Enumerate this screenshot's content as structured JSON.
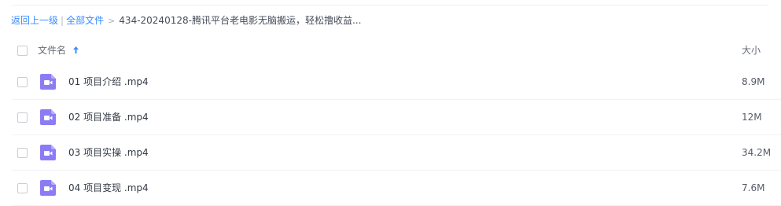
{
  "breadcrumb": {
    "back_label": "返回上一级",
    "separator": "|",
    "all_files_label": "全部文件",
    "arrow": ">",
    "current_folder": "434-20240128-腾讯平台老电影无脑搬运，轻松撸收益..."
  },
  "table": {
    "name_header": "文件名",
    "sort_direction": "ascending",
    "size_header": "大小"
  },
  "files": [
    {
      "name": "01 项目介绍 .mp4",
      "size": "8.9M",
      "icon": "video-file-icon"
    },
    {
      "name": "02 项目准备 .mp4",
      "size": "12M",
      "icon": "video-file-icon"
    },
    {
      "name": "03 项目实操 .mp4",
      "size": "34.2M",
      "icon": "video-file-icon"
    },
    {
      "name": "04 项目变现 .mp4",
      "size": "7.6M",
      "icon": "video-file-icon"
    }
  ],
  "colors": {
    "link": "#3b8cff",
    "video_icon_bg": "#8b7cf6",
    "video_icon_fold": "#b7acfa",
    "sort_arrow": "#3b8cff"
  }
}
